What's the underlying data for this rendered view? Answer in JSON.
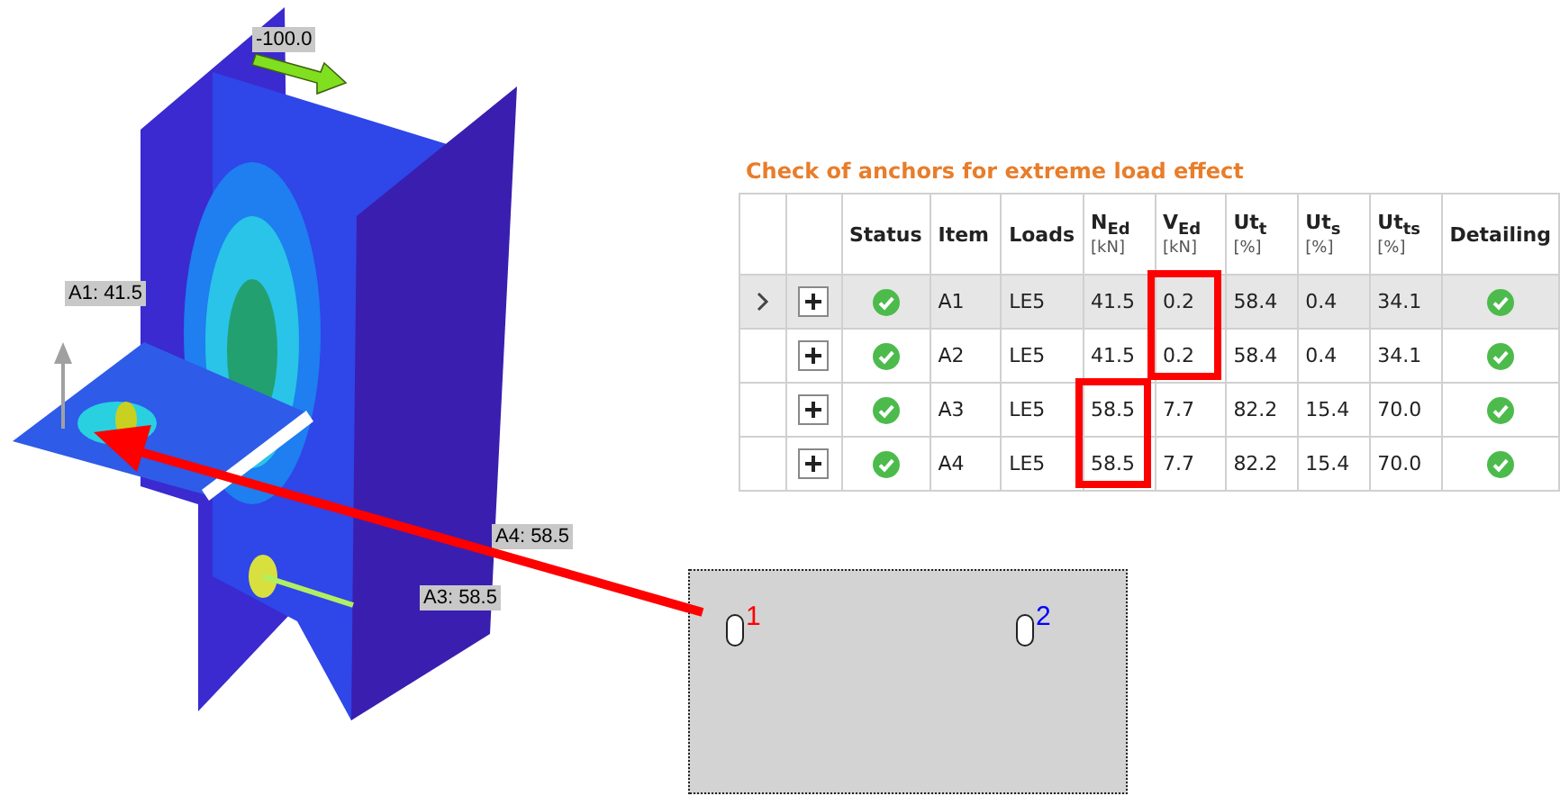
{
  "model_view": {
    "labels": [
      {
        "text": "-100.0",
        "kind": "load"
      },
      {
        "text": "A1: 41.5",
        "kind": "anchor"
      },
      {
        "text": "A4: 58.5",
        "kind": "anchor"
      },
      {
        "text": "A3: 58.5",
        "kind": "anchor"
      }
    ]
  },
  "table": {
    "title": "Check of anchors for extreme load effect",
    "columns": [
      {
        "label": "Status"
      },
      {
        "label": "Item"
      },
      {
        "label": "Loads"
      },
      {
        "label": "N$_{Ed}$",
        "unit": "[kN]"
      },
      {
        "label": "V$_{Ed}$",
        "unit": "[kN]"
      },
      {
        "label": "Ut$_{t}$",
        "unit": "[%]"
      },
      {
        "label": "Ut$_{s}$",
        "unit": "[%]"
      },
      {
        "label": "Ut$_{ts}$",
        "unit": "[%]"
      },
      {
        "label": "Detailing"
      }
    ],
    "rows": [
      {
        "selected": true,
        "cells": [
          {
            "kind": "check",
            "ok": true
          },
          {
            "kind": "text",
            "text": "A1"
          },
          {
            "kind": "text",
            "text": "LE5"
          },
          {
            "kind": "text",
            "text": "41.5"
          },
          {
            "kind": "text",
            "text": "0.2"
          },
          {
            "kind": "text",
            "text": "58.4"
          },
          {
            "kind": "text",
            "text": "0.4"
          },
          {
            "kind": "text",
            "text": "34.1"
          },
          {
            "kind": "check",
            "ok": true
          }
        ]
      },
      {
        "selected": false,
        "cells": [
          {
            "kind": "check",
            "ok": true
          },
          {
            "kind": "text",
            "text": "A2"
          },
          {
            "kind": "text",
            "text": "LE5"
          },
          {
            "kind": "text",
            "text": "41.5"
          },
          {
            "kind": "text",
            "text": "0.2"
          },
          {
            "kind": "text",
            "text": "58.4"
          },
          {
            "kind": "text",
            "text": "0.4"
          },
          {
            "kind": "text",
            "text": "34.1"
          },
          {
            "kind": "check",
            "ok": true
          }
        ]
      },
      {
        "selected": false,
        "cells": [
          {
            "kind": "check",
            "ok": true
          },
          {
            "kind": "text",
            "text": "A3"
          },
          {
            "kind": "text",
            "text": "LE5"
          },
          {
            "kind": "text",
            "text": "58.5"
          },
          {
            "kind": "text",
            "text": "7.7"
          },
          {
            "kind": "text",
            "text": "82.2"
          },
          {
            "kind": "text",
            "text": "15.4"
          },
          {
            "kind": "text",
            "text": "70.0"
          },
          {
            "kind": "check",
            "ok": true
          }
        ]
      },
      {
        "selected": false,
        "cells": [
          {
            "kind": "check",
            "ok": true
          },
          {
            "kind": "text",
            "text": "A4"
          },
          {
            "kind": "text",
            "text": "LE5"
          },
          {
            "kind": "text",
            "text": "58.5"
          },
          {
            "kind": "text",
            "text": "7.7"
          },
          {
            "kind": "text",
            "text": "82.2"
          },
          {
            "kind": "text",
            "text": "15.4"
          },
          {
            "kind": "text",
            "text": "70.0"
          },
          {
            "kind": "check",
            "ok": true
          }
        ]
      }
    ]
  },
  "plate": {
    "anchors": [
      {
        "number": "1",
        "color": "#ff0000"
      },
      {
        "number": "2",
        "color": "#0000ff"
      }
    ]
  }
}
